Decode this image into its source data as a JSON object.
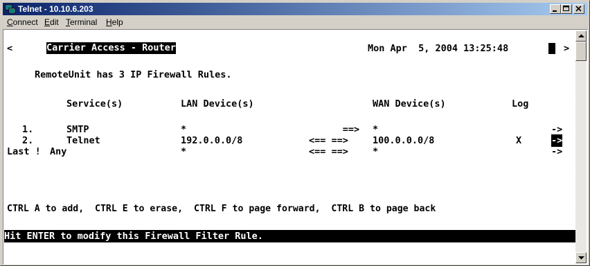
{
  "window": {
    "title": "Telnet - 10.10.6.203"
  },
  "menu": [
    {
      "label": "Connect",
      "accel": "C",
      "rest": "onnect"
    },
    {
      "label": "Edit",
      "accel": "E",
      "rest": "dit"
    },
    {
      "label": "Terminal",
      "accel": "T",
      "rest": "erminal"
    },
    {
      "label": "Help",
      "accel": "H",
      "rest": "elp"
    }
  ],
  "terminal": {
    "nav_left": "<",
    "header_title": "Carrier Access - Router",
    "header_datetime": "Mon Apr  5, 2004 13:25:48",
    "nav_right": ">",
    "rules_summary": "RemoteUnit has 3 IP Firewall Rules.",
    "columns": {
      "service": "Service(s)",
      "lan": "LAN Device(s)",
      "wan": "WAN Device(s)",
      "log": "Log"
    },
    "rows": [
      {
        "num": "1.",
        "service": "SMTP",
        "lan": "*",
        "direction": "      ==>",
        "wan": "*",
        "log": "",
        "arrow": "->"
      },
      {
        "num": "2.",
        "service": "Telnet",
        "lan": "192.0.0.0/8",
        "direction": "<== ==>",
        "wan": "100.0.0.0/8",
        "log": "X",
        "arrow": "->"
      },
      {
        "num": "Last !",
        "service": "Any",
        "lan": "*",
        "direction": "<== ==>",
        "wan": "*",
        "log": "",
        "arrow": "->"
      }
    ],
    "help_line": "CTRL A to add,  CTRL E to erase,  CTRL F to page forward,  CTRL B to page back",
    "status_line": "Hit ENTER to modify this Firewall Filter Rule."
  },
  "colors": {
    "titlebar_start": "#0a246a",
    "titlebar_end": "#a6caf0",
    "chrome": "#d4d0c8",
    "terminal_bg": "#ffffff",
    "terminal_fg": "#000000"
  }
}
